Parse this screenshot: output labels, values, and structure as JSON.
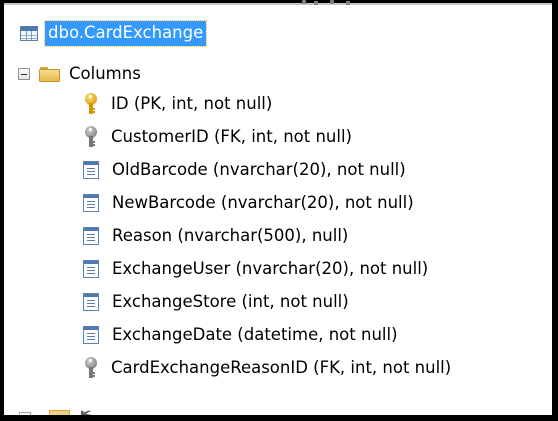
{
  "table": {
    "name": "dbo.CardExchange",
    "icon": "table-icon"
  },
  "folder": {
    "label": "Columns",
    "expand_state": "expanded",
    "icon": "folder-icon"
  },
  "columns": [
    {
      "label": "ID (PK, int, not null)",
      "icon": "primary-key-icon"
    },
    {
      "label": "CustomerID (FK, int, not null)",
      "icon": "foreign-key-icon"
    },
    {
      "label": "OldBarcode (nvarchar(20), not null)",
      "icon": "column-icon"
    },
    {
      "label": "NewBarcode (nvarchar(20), not null)",
      "icon": "column-icon"
    },
    {
      "label": "Reason (nvarchar(500), null)",
      "icon": "column-icon"
    },
    {
      "label": "ExchangeUser (nvarchar(20), not null)",
      "icon": "column-icon"
    },
    {
      "label": "ExchangeStore (int, not null)",
      "icon": "column-icon"
    },
    {
      "label": "ExchangeDate (datetime, not null)",
      "icon": "column-icon"
    },
    {
      "label": "CardExchangeReasonID (FK, int, not null)",
      "icon": "foreign-key-icon"
    }
  ],
  "colors": {
    "selection_background": "#3399ff",
    "selection_text": "#ffffff",
    "tree_text": "#000000",
    "primary_key": "#e3a418",
    "foreign_key": "#8a8a8a",
    "column_icon": "#4d79b0",
    "folder": "#e7b74c"
  }
}
